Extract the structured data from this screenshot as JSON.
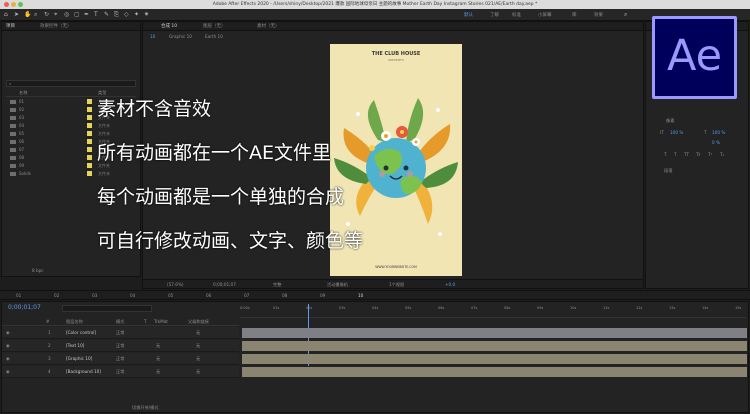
{
  "window": {
    "title": "Adobe After Effects 2020 - /Users/shiny/Desktop/2021 爆款 国际地球母亲日 主题的故事 Mother Earth Day Instagram Stories 021/AE/Earth day.aep *"
  },
  "toolbar": {
    "workspaces": [
      "默认",
      "了解",
      "标准",
      "小屏幕",
      "库",
      "效果"
    ],
    "active_workspace": "默认"
  },
  "project_panel": {
    "tabs": [
      "项目",
      "效果控件（无）"
    ],
    "column_headers": {
      "name": "名称",
      "type": "类型"
    },
    "items": [
      {
        "name": "01",
        "type": "文件夹"
      },
      {
        "name": "02",
        "type": "文件夹"
      },
      {
        "name": "03",
        "type": "文件夹"
      },
      {
        "name": "04",
        "type": "文件夹"
      },
      {
        "name": "05",
        "type": "文件夹"
      },
      {
        "name": "06",
        "type": "文件夹"
      },
      {
        "name": "07",
        "type": "文件夹"
      },
      {
        "name": "08",
        "type": "文件夹"
      },
      {
        "name": "09",
        "type": "文件夹"
      },
      {
        "name": "Solids",
        "type": "文件夹"
      }
    ],
    "bit_depth": "8 bpc"
  },
  "composition_panel": {
    "tabs": [
      "合成 10",
      "图层（无）",
      "素材（无）"
    ],
    "breadcrumb": [
      "10",
      "Graphic 10",
      "Earth 10"
    ],
    "zoom": "(57.6%)",
    "timecode": "0;00;01;07",
    "quality": "完整",
    "camera": "活动摄像机",
    "views": "1个视图",
    "exposure": "+0.0"
  },
  "card": {
    "title": "THE CLUB HOUSE",
    "subtitle": "PRESENTS",
    "footer": "WWW.YOURWEBSITE.COM"
  },
  "overlay_lines": [
    "素材不含音效",
    "所有动画都在一个AE文件里",
    "每个动画都是一个单独的合成",
    "可自行修改动画、文字、颜色等"
  ],
  "logo": {
    "text": "Ae"
  },
  "right_panel": {
    "title": "字符",
    "font_size": "100 %",
    "tracking": "0 %",
    "unit": "像素",
    "paragraph": "段落"
  },
  "comp_tabs": [
    "01",
    "02",
    "03",
    "04",
    "05",
    "06",
    "07",
    "08",
    "09",
    "10"
  ],
  "timeline": {
    "timecode": "0;00;01;07",
    "headers": [
      "#",
      "图层名称",
      "模式",
      "T",
      "TrkMat",
      "父级和链接"
    ],
    "rows": [
      {
        "num": "1",
        "name": "[Color control]",
        "mode": "正常",
        "trkmat": "",
        "parent": "无"
      },
      {
        "num": "2",
        "name": "[Text 10]",
        "mode": "正常",
        "trkmat": "无",
        "parent": "无"
      },
      {
        "num": "3",
        "name": "[Graphic 10]",
        "mode": "正常",
        "trkmat": "无",
        "parent": "无"
      },
      {
        "num": "4",
        "name": "[Background 10]",
        "mode": "正常",
        "trkmat": "无",
        "parent": "无"
      }
    ],
    "ruler": [
      "0:00s",
      "01s",
      "02s",
      "03s",
      "04s",
      "05s",
      "06s",
      "07s",
      "08s",
      "09s",
      "10s",
      "11s",
      "12s",
      "13s",
      "14s",
      "15s"
    ],
    "footer_label": "切换开关/模式"
  },
  "colors": {
    "accent": "#5a9bea",
    "ae_bg": "#00005b",
    "ae_fg": "#9999ff",
    "card_bg": "#f0e5b3",
    "layer_bar": "#8a8470"
  }
}
